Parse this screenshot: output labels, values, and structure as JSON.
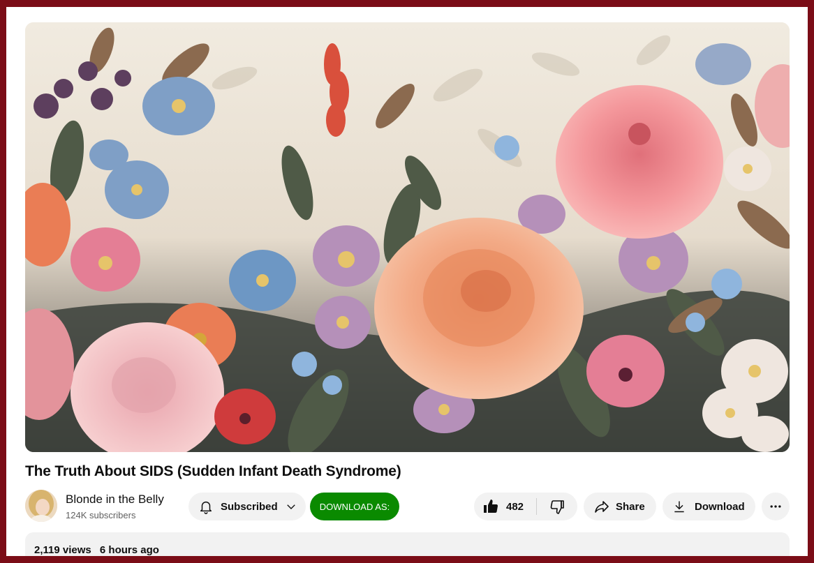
{
  "video": {
    "title": "The Truth About SIDS (Sudden Infant Death Syndrome)"
  },
  "channel": {
    "name": "Blonde in the Belly",
    "subscribers": "124K subscribers"
  },
  "actions": {
    "subscribed_label": "Subscribed",
    "download_as_label": "DOWNLOAD AS:",
    "like_count": "482",
    "share_label": "Share",
    "download_label": "Download"
  },
  "description": {
    "views": "2,119 views",
    "posted": "6 hours ago"
  },
  "colors": {
    "frame": "#7b0d17",
    "download_as_bg": "#0a8a00",
    "pill_bg": "#f2f2f2"
  },
  "icons": [
    "bell-icon",
    "chevron-down-icon",
    "thumbs-up-icon",
    "thumbs-down-icon",
    "share-arrow-icon",
    "download-icon",
    "more-horizontal-icon"
  ]
}
